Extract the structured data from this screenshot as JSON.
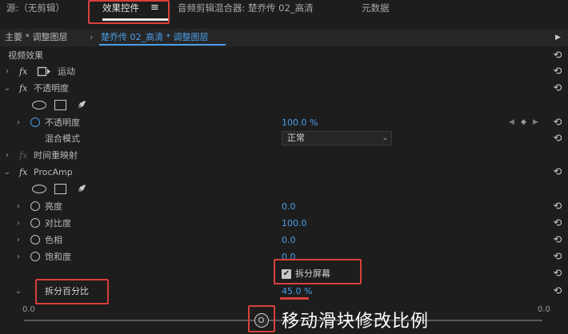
{
  "tabs": [
    {
      "label": "源:（无剪辑）"
    },
    {
      "label": "效果控件"
    },
    {
      "label": "音频剪辑混合器: 楚乔传 02_高清"
    },
    {
      "label": "元数据"
    }
  ],
  "menu_glyph": "≡",
  "breadcrumb": {
    "master": "主要 * 调整图层",
    "clip": "楚乔传 02_高清 * 调整图层"
  },
  "section_title": "视频效果",
  "effects": {
    "motion": "运动",
    "opacity": {
      "title": "不透明度",
      "prop_label": "不透明度",
      "prop_value": "100.0 %",
      "blend_label": "混合模式",
      "blend_value": "正常"
    },
    "time_remap": "时间重映射",
    "procamp": {
      "title": "ProcAmp",
      "brightness_label": "亮度",
      "brightness_value": "0.0",
      "contrast_label": "对比度",
      "contrast_value": "100.0",
      "hue_label": "色相",
      "hue_value": "0.0",
      "saturation_label": "饱和度",
      "saturation_value": "0.0",
      "split_screen_label": "拆分屏幕",
      "split_percent_label": "拆分百分比",
      "split_percent_value": "45.0 %",
      "slider_min": "0.0",
      "slider_max": "0.0"
    }
  },
  "slider_fraction": 0.45,
  "annotation": "移动滑块修改比例",
  "colors": {
    "accent": "#4a9fe8",
    "highlight": "#d9403a"
  }
}
